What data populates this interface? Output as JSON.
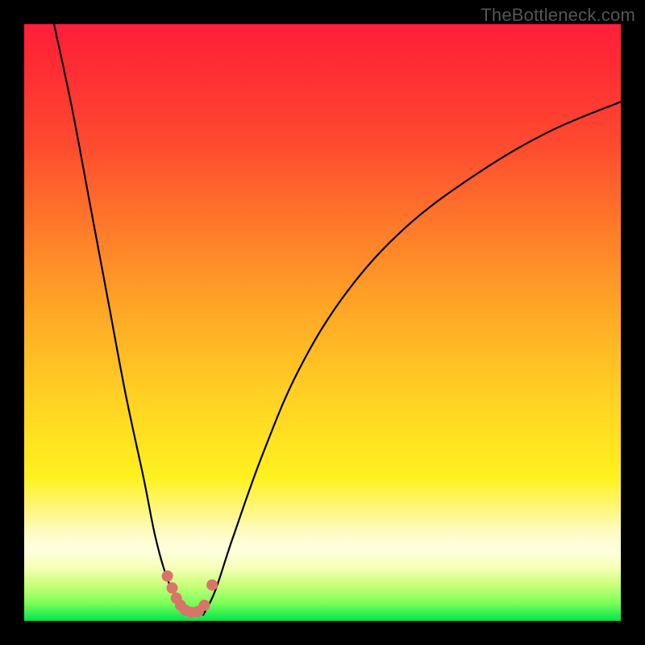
{
  "watermark": "TheBottleneck.com",
  "colors": {
    "frame_border": "#000000",
    "curve_stroke": "#000000",
    "marker_fill": "#d9746b",
    "gradient_top": "#ff1f3a",
    "gradient_bottom": "#00e64a"
  },
  "chart_data": {
    "type": "line",
    "title": "",
    "xlabel": "",
    "ylabel": "",
    "xlim": [
      0,
      100
    ],
    "ylim": [
      0,
      100
    ],
    "grid": false,
    "legend": false,
    "note": "No axis tick labels or numeric annotations are rendered in the image; values are visual estimates on a 0–100 coordinate space.",
    "series": [
      {
        "name": "left-branch",
        "x": [
          5,
          8,
          11,
          14,
          17,
          20,
          22,
          24,
          26,
          27
        ],
        "y": [
          100,
          86,
          70,
          54,
          38,
          24,
          14,
          7,
          3,
          1
        ]
      },
      {
        "name": "right-branch",
        "x": [
          30,
          32,
          35,
          40,
          46,
          54,
          64,
          76,
          88,
          100
        ],
        "y": [
          1,
          5,
          14,
          28,
          42,
          55,
          66,
          75,
          82,
          87
        ]
      }
    ],
    "markers": [
      {
        "x": 24.0,
        "y": 7.5
      },
      {
        "x": 24.8,
        "y": 5.5
      },
      {
        "x": 25.5,
        "y": 3.8
      },
      {
        "x": 26.2,
        "y": 2.6
      },
      {
        "x": 27.0,
        "y": 1.8
      },
      {
        "x": 28.0,
        "y": 1.4
      },
      {
        "x": 29.2,
        "y": 1.6
      },
      {
        "x": 30.2,
        "y": 2.6
      },
      {
        "x": 31.5,
        "y": 6.0
      }
    ],
    "marker_radius": 7
  }
}
